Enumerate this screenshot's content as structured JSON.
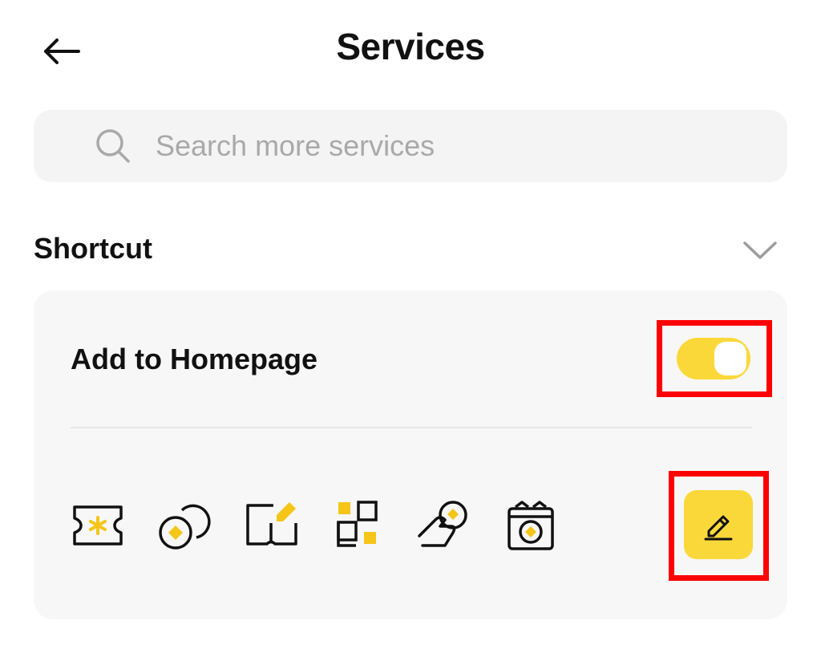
{
  "header": {
    "title": "Services",
    "back_icon": "arrow-left-icon"
  },
  "search": {
    "placeholder": "Search more services",
    "value": "",
    "icon": "search-icon"
  },
  "section": {
    "title": "Shortcut",
    "chevron_icon": "chevron-down-icon"
  },
  "card": {
    "add_to_homepage_label": "Add to Homepage",
    "toggle_on": true,
    "shortcut_icons": [
      "ticket-icon",
      "coins-icon",
      "book-edit-icon",
      "apps-grid-icon",
      "hand-coin-icon",
      "gift-icon"
    ],
    "edit_icon": "pencil-icon"
  },
  "colors": {
    "accent": "#fbd83a",
    "icon_stroke": "#111111",
    "card_bg": "#f7f7f7",
    "search_bg": "#f4f4f4",
    "placeholder": "#a9a9a9",
    "annotation": "#ff0000"
  }
}
